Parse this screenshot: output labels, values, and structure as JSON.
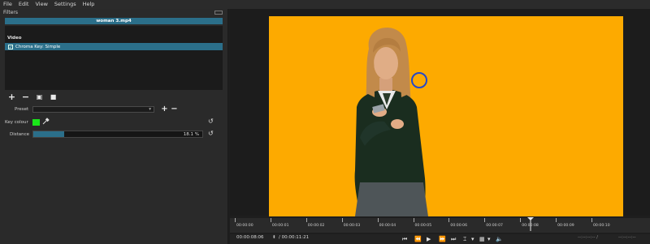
{
  "menu": [
    "File",
    "Edit",
    "View",
    "Settings",
    "Help"
  ],
  "panel": {
    "title": "Filters",
    "clip_name": "woman 3.mp4",
    "category": "Video",
    "filter_checked": "✓",
    "filter_name": "Chroma Key: Simple"
  },
  "toolbar": {
    "add_icon": "+",
    "remove_icon": "−",
    "copy_icon": "▣",
    "paste_icon": "■"
  },
  "params": {
    "preset_label": "Preset",
    "preset_value": "",
    "preset_arrow": "▾",
    "key_colour_label": "Key colour",
    "key_colour": "#19e619",
    "distance_label": "Distance",
    "distance_value": "18.1 %",
    "distance_fraction": 0.181,
    "reset_icon": "↺",
    "plus": "+",
    "minus": "−"
  },
  "preview": {
    "background_color": "#fdaa00"
  },
  "timeline": {
    "ticks": [
      "00:00:00",
      "00:00:01",
      "00:00:02",
      "00:00:03",
      "00:00:04",
      "00:00:05",
      "00:00:06",
      "00:00:07",
      "00:00:08",
      "00:00:09",
      "00:00:10"
    ]
  },
  "transport": {
    "position": "00:00:08:06",
    "duration": "/ 00:00:11:21",
    "in_point": "--:--:--:-- /",
    "out_point": "--:--:--:--",
    "controls": [
      "⏮",
      "⏪",
      "▶",
      "⏩",
      "⏭",
      "⌶",
      "▾",
      "▦",
      "▾",
      "🔈"
    ]
  }
}
